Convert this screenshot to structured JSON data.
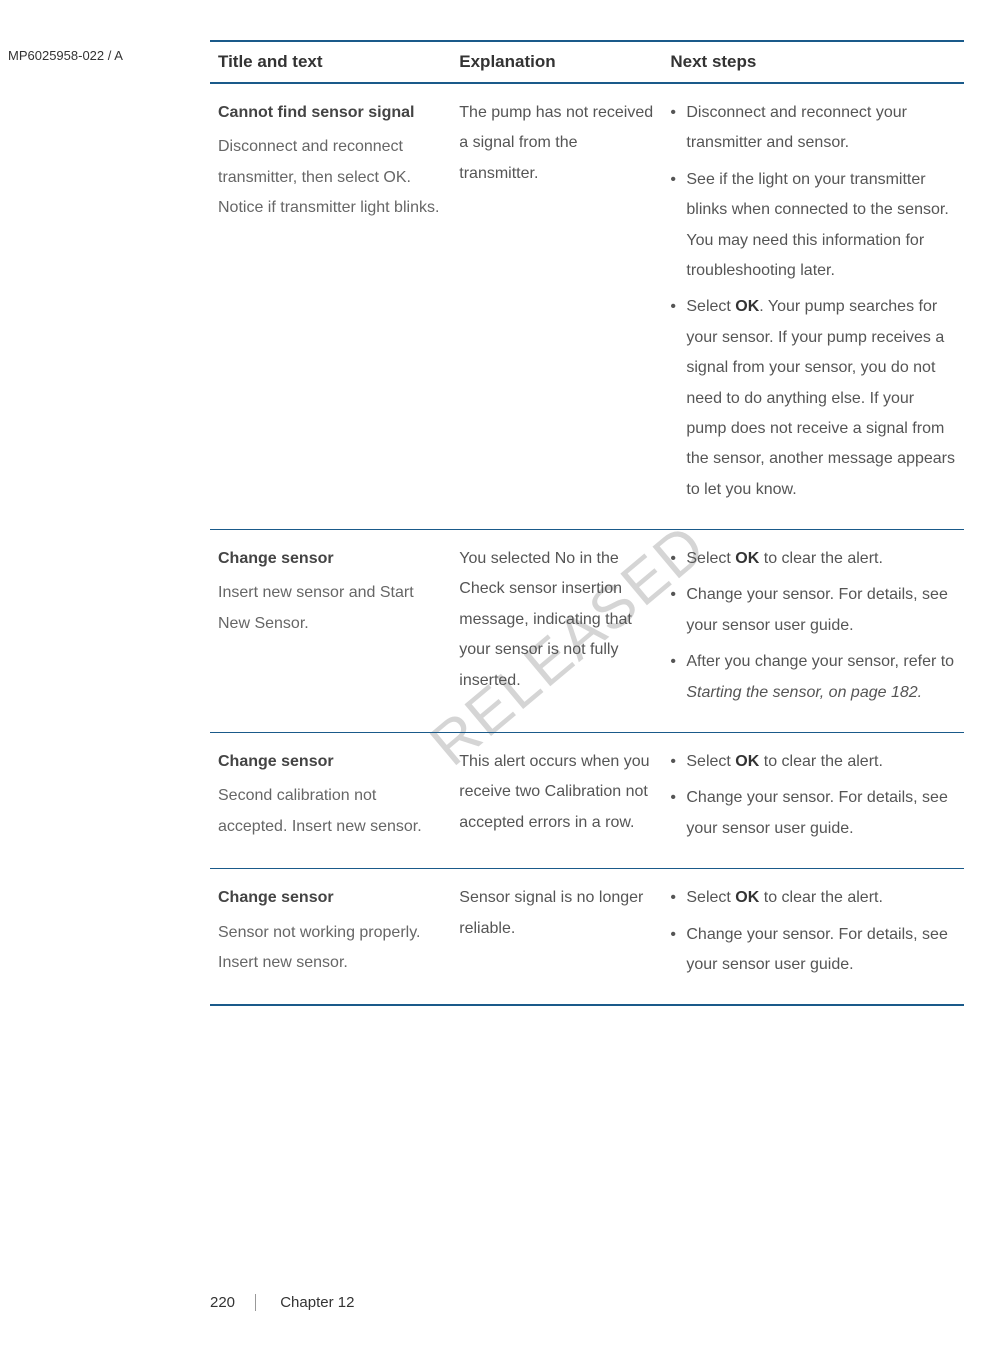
{
  "docId": "MP6025958-022 / A",
  "watermark": "RELEASED",
  "headers": {
    "col1": "Title and text",
    "col2": "Explanation",
    "col3": "Next steps"
  },
  "rows": [
    {
      "title": "Cannot find sensor signal",
      "subtext": "Disconnect and reconnect transmitter, then select OK. Notice if transmitter light blinks.",
      "explanation": "The pump has not received a signal from the transmitter.",
      "steps": [
        {
          "pre": "",
          "bold": "",
          "text": "Disconnect and reconnect your transmitter and sensor."
        },
        {
          "pre": "",
          "bold": "",
          "text": "See if the light on your transmitter blinks when connected to the sensor. You may need this information for troubleshooting later."
        },
        {
          "pre": "Select ",
          "bold": "OK",
          "text": ". Your pump searches for your sensor. If your pump receives a signal from your sensor, you do not need to do anything else. If your pump does not receive a signal from the sensor, another message appears to let you know."
        }
      ]
    },
    {
      "title": "Change sensor",
      "subtext": "Insert new sensor and Start New Sensor.",
      "explanation": "You selected No in the Check sensor insertion message, indicating that your sensor is not fully inserted.",
      "steps": [
        {
          "pre": "Select ",
          "bold": "OK",
          "text": " to clear the alert."
        },
        {
          "pre": "",
          "bold": "",
          "text": "Change your sensor. For details, see your sensor user guide."
        },
        {
          "pre": "After you change your sensor, refer to ",
          "bold": "",
          "text": "",
          "italic": "Starting the sensor, on page 182."
        }
      ]
    },
    {
      "title": "Change sensor",
      "subtext": "Second calibration not accepted. Insert new sensor.",
      "explanation": "This alert occurs when you receive two Calibration not accepted errors in a row.",
      "steps": [
        {
          "pre": "Select ",
          "bold": "OK",
          "text": " to clear the alert."
        },
        {
          "pre": "",
          "bold": "",
          "text": "Change your sensor. For details, see your sensor user guide."
        }
      ]
    },
    {
      "title": "Change sensor",
      "subtext": "Sensor not working properly. Insert new sensor.",
      "explanation": "Sensor signal is no longer reliable.",
      "steps": [
        {
          "pre": "Select ",
          "bold": "OK",
          "text": " to clear the alert."
        },
        {
          "pre": "",
          "bold": "",
          "text": "Change your sensor. For details, see your sensor user guide."
        }
      ]
    }
  ],
  "footer": {
    "page": "220",
    "chapter": "Chapter 12"
  }
}
